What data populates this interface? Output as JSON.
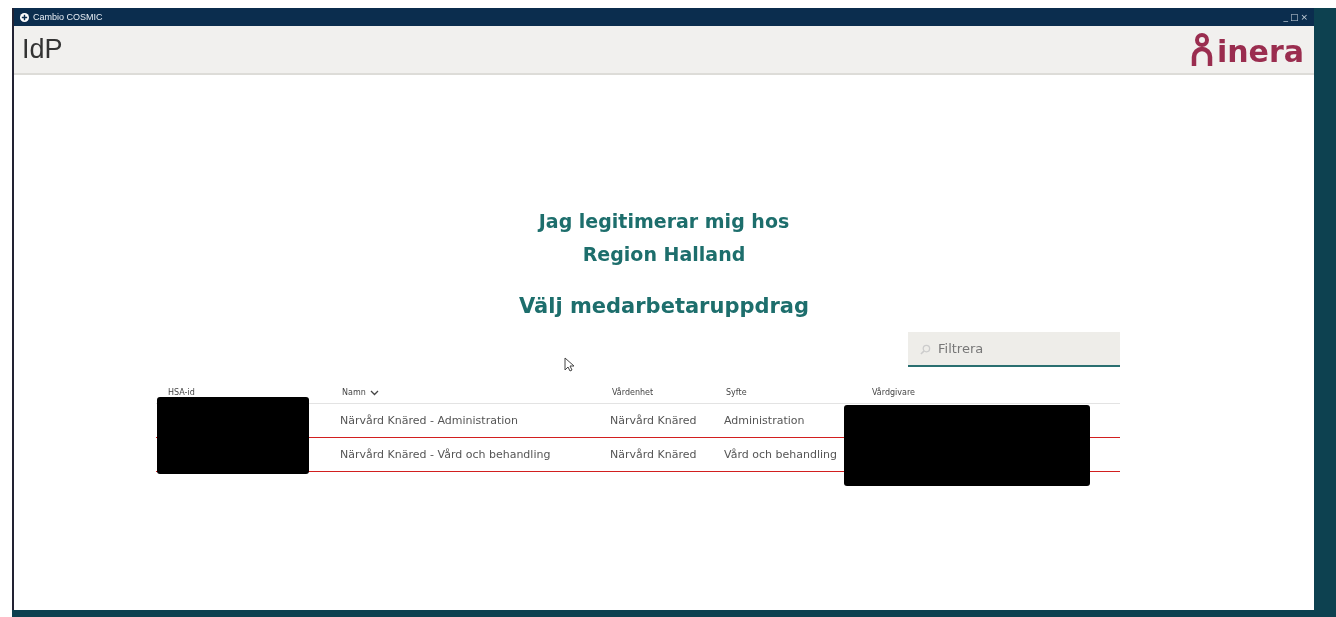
{
  "window": {
    "title": "Cambio COSMIC",
    "controls": [
      "_",
      "□",
      "×"
    ]
  },
  "header": {
    "title": "IdP",
    "logo": "inera"
  },
  "heading": {
    "lines": [
      "Jag legitimerar mig hos",
      "Region Halland"
    ],
    "subtitle": "Välj medarbetaruppdrag"
  },
  "filter": {
    "placeholder": "Filtrera"
  },
  "table": {
    "columns": [
      {
        "label": "HSA-id",
        "sorted": false
      },
      {
        "label": "Namn",
        "sorted": true
      },
      {
        "label": "Vårdenhet",
        "sorted": false
      },
      {
        "label": "Syfte",
        "sorted": false
      },
      {
        "label": "Vårdgivare",
        "sorted": false
      }
    ],
    "rows": [
      {
        "selected": false,
        "cells": [
          "",
          "Närvård Knäred - Administration",
          "Närvård Knäred",
          "Administration",
          ""
        ]
      },
      {
        "selected": true,
        "cells": [
          "",
          "Närvård Knäred - Vård och behandling",
          "Närvård Knäred",
          "Vård och behandling",
          ""
        ]
      }
    ]
  }
}
